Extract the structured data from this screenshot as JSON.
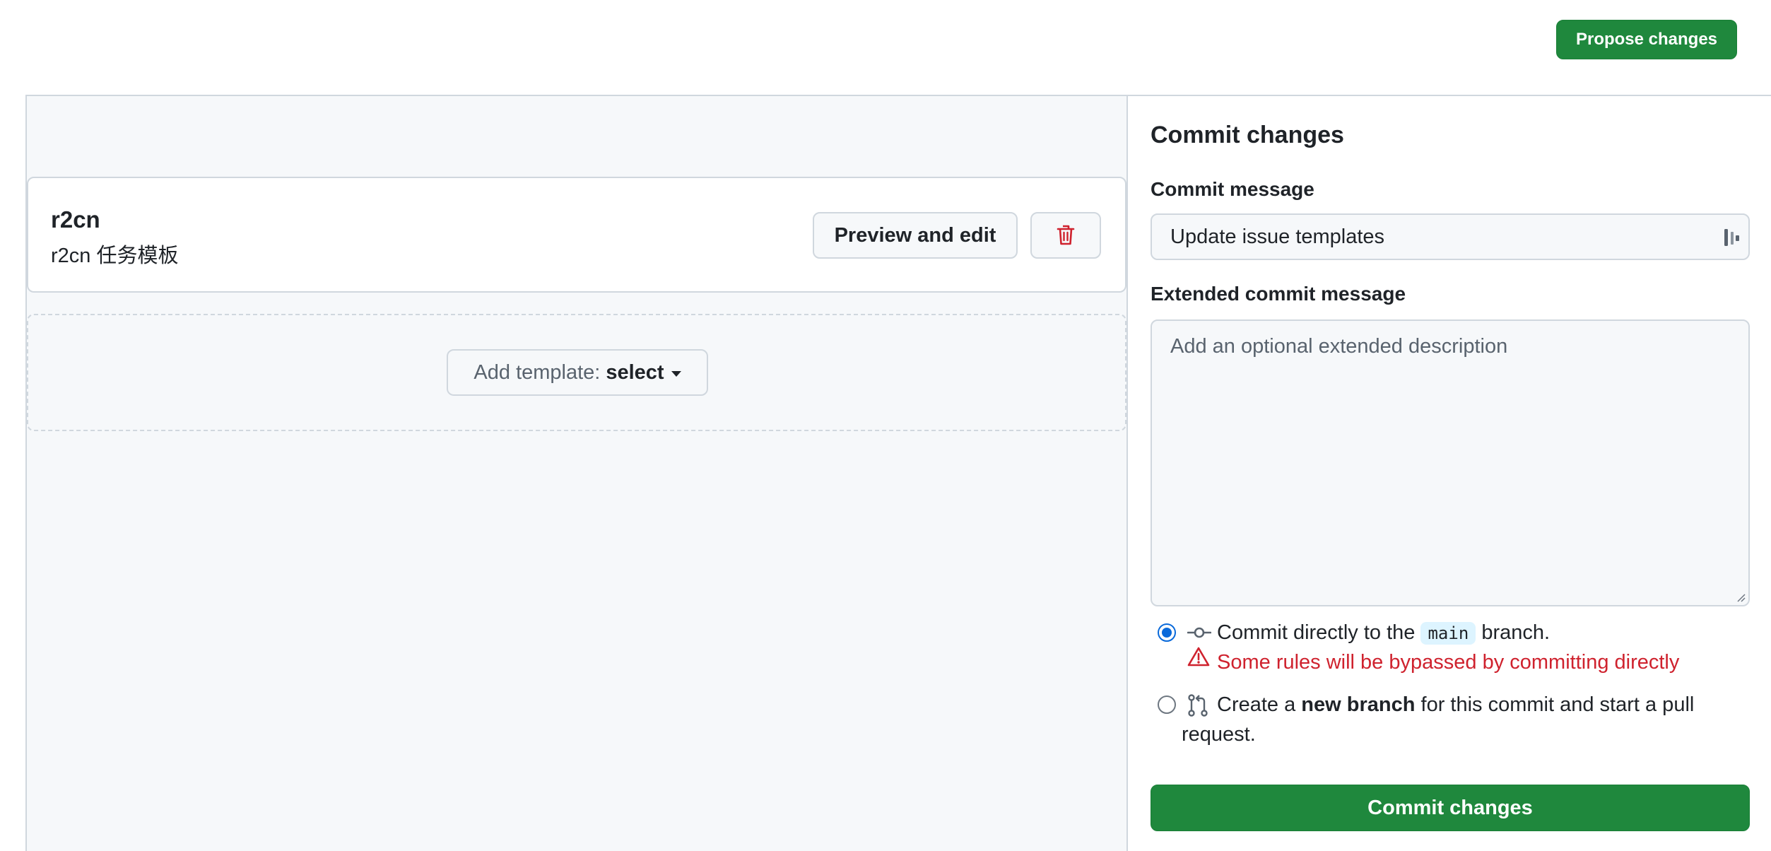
{
  "header": {
    "propose_label": "Propose changes"
  },
  "templates": {
    "items": [
      {
        "name": "r2cn",
        "description": "r2cn 任务模板"
      }
    ],
    "preview_label": "Preview and edit",
    "delete_icon": "trash-icon",
    "add_template_prefix": "Add template:",
    "add_template_value": "select"
  },
  "commit_panel": {
    "title": "Commit changes",
    "message_label": "Commit message",
    "message_value": "Update issue templates",
    "extended_label": "Extended commit message",
    "extended_placeholder": "Add an optional extended description",
    "option_direct_prefix": "Commit directly to the",
    "branch_name": "main",
    "option_direct_suffix": "branch.",
    "warning": "Some rules will be bypassed by committing directly",
    "option_new_prefix": "Create a",
    "option_new_bold": "new branch",
    "option_new_suffix_line1": "for this commit and start a pull",
    "option_new_suffix_line2": "request.",
    "selected_option": "direct",
    "commit_button": "Commit changes"
  },
  "colors": {
    "primary_green": "#1f883d",
    "danger_red": "#cf222e",
    "accent_blue": "#0969da",
    "border": "#d0d7de",
    "canvas_subtle": "#f6f8fa"
  }
}
